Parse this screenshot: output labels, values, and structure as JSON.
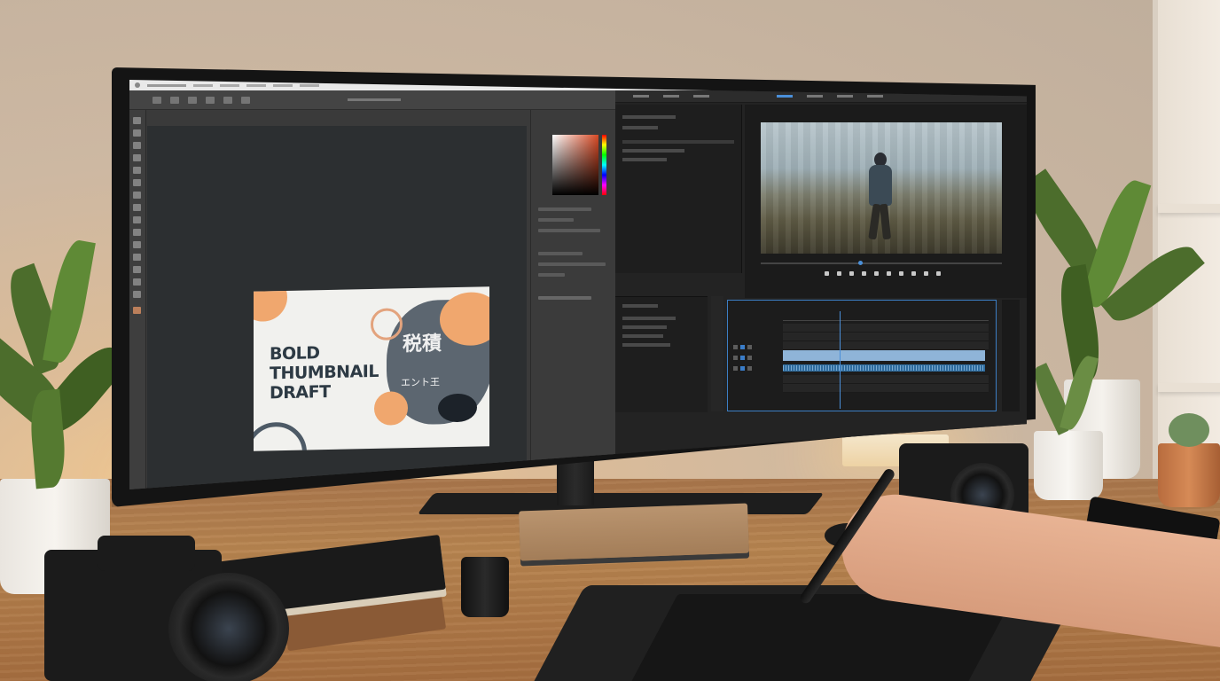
{
  "thumbnail": {
    "title_lines": [
      "BOLD",
      "THUMBNAIL",
      "DRAFT"
    ],
    "jp_line1": "税積",
    "jp_line2": "エント王"
  }
}
